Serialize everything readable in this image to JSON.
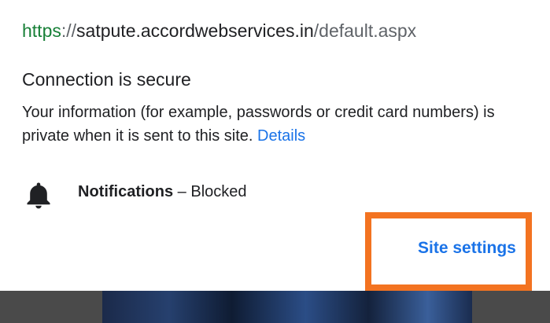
{
  "site": {
    "scheme": "https",
    "separator": "://",
    "host": "satpute.accordwebservices.in",
    "path": "/default.aspx"
  },
  "connection": {
    "title": "Connection is secure",
    "description": "Your information (for example, passwords or credit card numbers) is private when it is sent to this site.",
    "details_link": "Details"
  },
  "permissions": [
    {
      "icon": "bell-icon",
      "name": "Notifications",
      "separator": " – ",
      "status": "Blocked"
    }
  ],
  "actions": {
    "site_settings_label": "Site settings"
  },
  "colors": {
    "scheme_green": "#188038",
    "link_blue": "#1a73e8",
    "highlight_orange": "#f37321"
  }
}
